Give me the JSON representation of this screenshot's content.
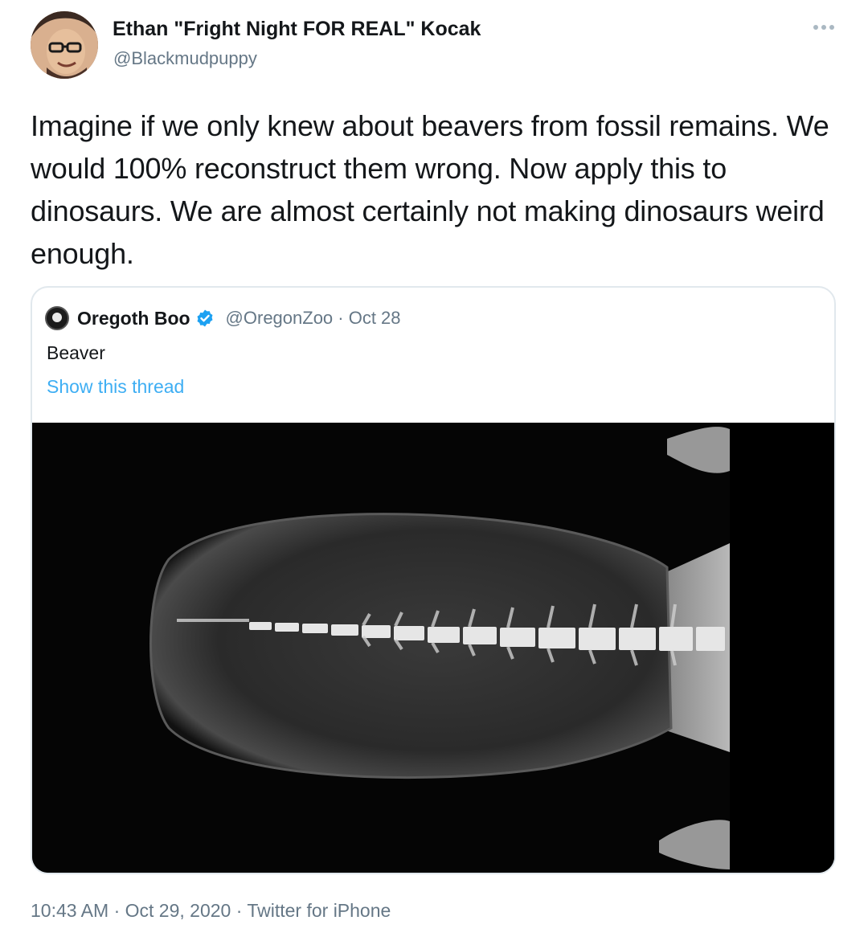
{
  "author": {
    "display_name": "Ethan \"Fright Night FOR REAL\" Kocak",
    "handle": "@Blackmudpuppy"
  },
  "tweet": {
    "text": "Imagine if we only knew about beavers from fossil remains. We would 100% reconstruct them wrong. Now apply this to dinosaurs. We are almost certainly not making dinosaurs weird enough."
  },
  "quoted_tweet": {
    "display_name": "Oregoth Boo",
    "meta": "@OregonZoo · Oct 28",
    "text": "Beaver",
    "show_thread_label": "Show this thread",
    "image_icon": "x-ray-beaver-tail"
  },
  "footer": {
    "meta": "10:43 AM · Oct 29, 2020 · Twitter for iPhone"
  },
  "colors": {
    "primary_text": "#14171a",
    "secondary_text": "#657786",
    "link": "#1da1f2",
    "border": "#e1e8ed",
    "verified": "#1da1f2"
  },
  "icons": {
    "more": "more-dots-icon",
    "verified": "verified-badge-icon"
  }
}
